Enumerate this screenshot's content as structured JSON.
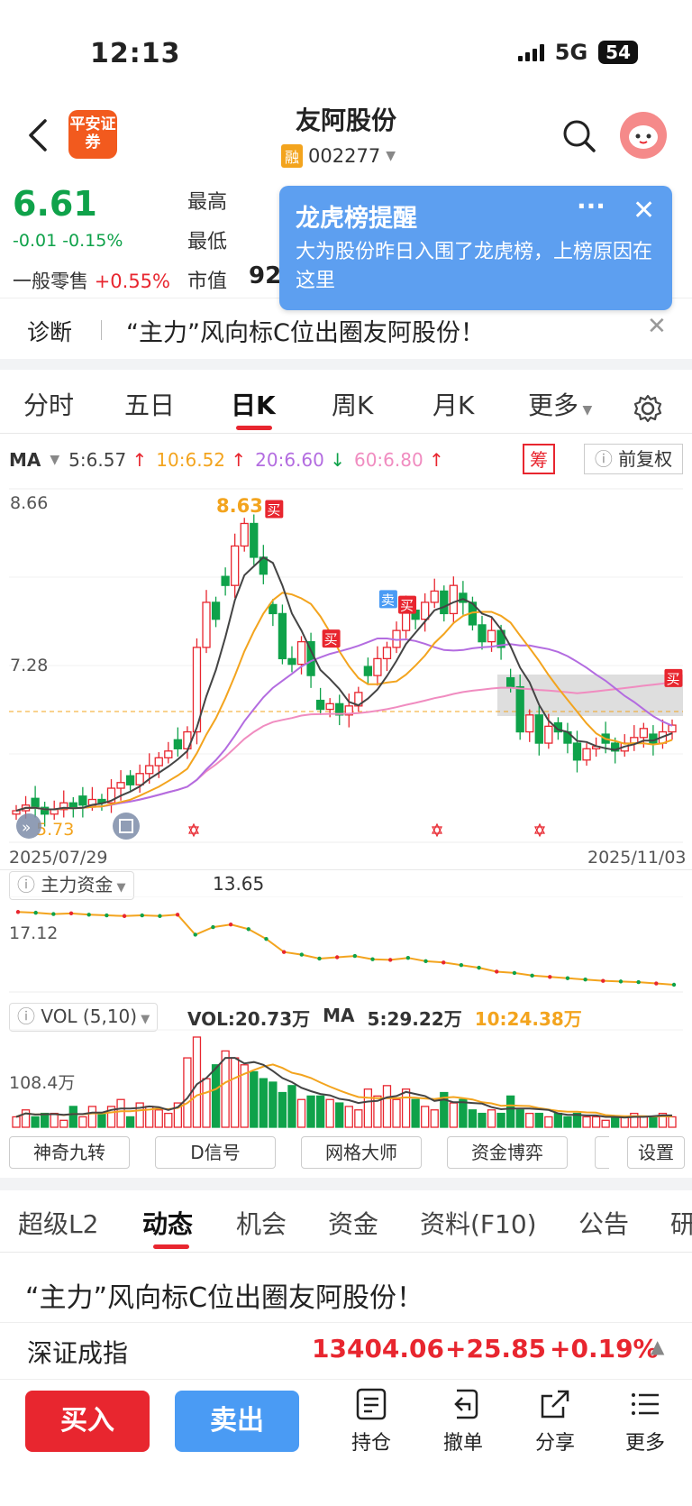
{
  "status": {
    "time": "12:13",
    "network": "5G",
    "battery": "54"
  },
  "header": {
    "logo_text": "平安证券",
    "title": "友阿股份",
    "badge": "融",
    "code": "002277"
  },
  "quote": {
    "price": "6.61",
    "change": "-0.01 -0.15%",
    "retail_label": "一般零售",
    "retail_change": "+0.55%",
    "high_label": "最高",
    "low_label": "最低",
    "mcap_label": "市值",
    "mcap_value": "92"
  },
  "popup": {
    "title": "龙虎榜提醒",
    "more": "···",
    "body": "大为股份昨日入围了龙虎榜，上榜原因在这里"
  },
  "diagnosis": {
    "label": "诊断",
    "text": "“主力”风向标C位出圈友阿股份！"
  },
  "period_tabs": [
    "分时",
    "五日",
    "日K",
    "周K",
    "月K",
    "更多"
  ],
  "ma": {
    "label": "MA",
    "ma5": "5:6.57",
    "ma10": "10:6.52",
    "ma20": "20:6.60",
    "ma60": "60:6.80"
  },
  "chart_buttons": {
    "chou": "筹",
    "fq": "前复权"
  },
  "colors": {
    "up": "#e8262f",
    "down": "#0fa24a",
    "ma5": "#444444",
    "ma10": "#f3a41e",
    "ma20": "#b36ce0",
    "ma60": "#f08cc0"
  },
  "kline": {
    "y_top_label": "8.66",
    "y_mid_label": "7.28",
    "y_bottom_label": "5.73",
    "max_label": "8.63",
    "date_start": "2025/07/29",
    "date_end": "2025/11/03",
    "markers": [
      "买",
      "买",
      "卖",
      "买",
      "买"
    ]
  },
  "fund": {
    "label": "主力资金",
    "value": "13.65",
    "axis_label": "17.12"
  },
  "vol": {
    "label": "VOL (5,10)",
    "vol": "VOL:20.73万",
    "ma_label": "MA",
    "ma5": "5:29.22万",
    "ma10": "10:24.38万",
    "axis_label": "108.4万"
  },
  "tools": [
    "神奇九转",
    "D信号",
    "网格大师",
    "资金博弈",
    "设置"
  ],
  "news_tabs": [
    "超级L2",
    "动态",
    "机会",
    "资金",
    "资料(F10)",
    "公告",
    "研"
  ],
  "headline": "“主力”风向标C位出圈友阿股份！",
  "index": {
    "name": "深证成指",
    "value": "13404.06",
    "change": "+25.85",
    "pct": "+0.19%"
  },
  "actions": {
    "buy": "买入",
    "sell": "卖出"
  },
  "bottom_nav": [
    "持仓",
    "撤单",
    "分享",
    "更多"
  ],
  "chart_data": {
    "type": "candlestick",
    "x_range": [
      "2025/07/29",
      "2025/11/03"
    ],
    "y_range": [
      5.73,
      8.66
    ],
    "y_ticks": [
      8.66,
      7.28,
      5.73
    ],
    "max_price": 8.63,
    "ma_values": {
      "MA5": 6.57,
      "MA10": 6.52,
      "MA20": 6.6,
      "MA60": 6.8
    },
    "close": [
      5.85,
      5.9,
      5.88,
      5.82,
      5.86,
      5.92,
      5.88,
      5.9,
      5.95,
      5.92,
      6.05,
      6.1,
      6.08,
      6.18,
      6.25,
      6.32,
      6.38,
      6.4,
      6.55,
      7.3,
      7.7,
      7.55,
      7.85,
      8.2,
      8.4,
      8.1,
      7.95,
      7.6,
      7.2,
      7.15,
      7.35,
      7.05,
      6.75,
      6.8,
      6.7,
      6.78,
      6.9,
      7.05,
      7.2,
      7.3,
      7.45,
      7.65,
      7.55,
      7.7,
      7.8,
      7.6,
      7.85,
      7.7,
      7.5,
      7.35,
      7.45,
      7.3,
      6.95,
      6.55,
      6.7,
      6.45,
      6.6,
      6.55,
      6.45,
      6.3,
      6.4,
      6.42,
      6.45,
      6.38,
      6.45,
      6.5,
      6.58,
      6.45,
      6.55,
      6.61
    ],
    "fund_line": [
      17.12,
      17.0,
      16.8,
      16.9,
      16.7,
      16.6,
      16.5,
      16.6,
      16.5,
      16.7,
      13.65,
      14.8,
      15.2,
      14.5,
      13.0,
      11.0,
      10.6,
      10.0,
      10.2,
      10.4,
      9.9,
      9.8,
      10.1,
      9.6,
      9.4,
      9.0,
      8.6,
      8.0,
      7.8,
      7.4,
      7.2,
      7.0,
      6.8,
      6.6,
      6.5,
      6.4,
      6.2,
      6.0
    ],
    "volume": [
      3,
      5,
      3,
      4,
      4,
      2,
      6,
      3,
      6,
      4,
      6,
      8,
      3,
      7,
      6,
      5,
      4,
      7,
      20,
      26,
      14,
      18,
      22,
      20,
      18,
      16,
      14,
      13,
      10,
      12,
      8,
      9,
      9,
      8,
      7,
      6,
      5,
      11,
      9,
      12,
      8,
      11,
      8,
      6,
      5,
      10,
      7,
      8,
      5,
      4,
      5,
      4,
      9,
      5,
      4,
      4,
      3,
      4,
      3,
      4,
      3,
      3,
      2,
      3,
      3,
      4,
      3,
      3,
      4,
      3
    ],
    "volume_unit": "万",
    "volume_axis": 108.4
  }
}
